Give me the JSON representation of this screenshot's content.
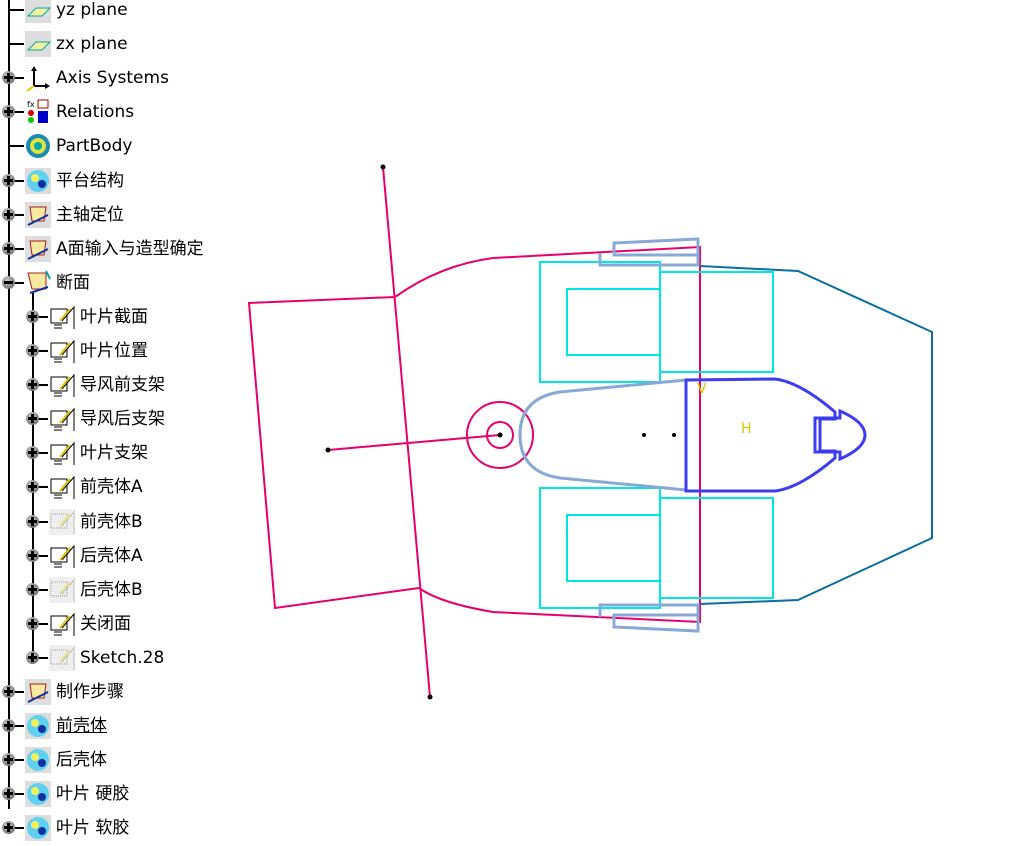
{
  "tree": {
    "items": [
      {
        "label": "yz plane",
        "icon": "plane-icon",
        "expander": "none",
        "level": 0
      },
      {
        "label": "zx plane",
        "icon": "plane-icon",
        "expander": "none",
        "level": 0
      },
      {
        "label": "Axis Systems",
        "icon": "axis-system-icon",
        "expander": "plus",
        "level": 0
      },
      {
        "label": "Relations",
        "icon": "relations-icon",
        "expander": "plus",
        "level": 0
      },
      {
        "label": "PartBody",
        "icon": "part-body-icon",
        "expander": "none",
        "level": 0
      },
      {
        "label": "平台结构",
        "icon": "geometrical-set-icon",
        "expander": "plus",
        "level": 0
      },
      {
        "label": "主轴定位",
        "icon": "ordered-geometrical-set-icon",
        "expander": "plus",
        "level": 0
      },
      {
        "label": "A面输入与造型确定",
        "icon": "ordered-geometrical-set-icon",
        "expander": "plus",
        "level": 0
      },
      {
        "label": "断面",
        "icon": "ordered-geometrical-set-open-icon",
        "expander": "minus",
        "level": 0
      },
      {
        "label": "叶片截面",
        "icon": "sketch-icon",
        "expander": "plus",
        "level": 1
      },
      {
        "label": "叶片位置",
        "icon": "sketch-icon",
        "expander": "plus",
        "level": 1
      },
      {
        "label": "导风前支架",
        "icon": "sketch-icon",
        "expander": "plus",
        "level": 1
      },
      {
        "label": "导风后支架",
        "icon": "sketch-icon",
        "expander": "plus",
        "level": 1
      },
      {
        "label": "叶片支架",
        "icon": "sketch-icon",
        "expander": "plus",
        "level": 1
      },
      {
        "label": "前壳体A",
        "icon": "sketch-icon",
        "expander": "plus",
        "level": 1
      },
      {
        "label": "前壳体B",
        "icon": "sketch-hidden-icon",
        "expander": "plus",
        "level": 1
      },
      {
        "label": "后壳体A",
        "icon": "sketch-icon",
        "expander": "plus",
        "level": 1
      },
      {
        "label": "后壳体B",
        "icon": "sketch-hidden-icon",
        "expander": "plus",
        "level": 1
      },
      {
        "label": "关闭面",
        "icon": "sketch-icon",
        "expander": "plus",
        "level": 1
      },
      {
        "label": "Sketch.28",
        "icon": "sketch-hidden-icon",
        "expander": "plus",
        "level": 1
      },
      {
        "label": "制作步骤",
        "icon": "ordered-geometrical-set-icon",
        "expander": "plus",
        "level": 0
      },
      {
        "label": "前壳体",
        "icon": "geometrical-set-icon",
        "expander": "plus",
        "level": 0,
        "underlined": true
      },
      {
        "label": "后壳体",
        "icon": "geometrical-set-icon",
        "expander": "plus",
        "level": 0
      },
      {
        "label": "叶片 硬胶",
        "icon": "geometrical-set-icon",
        "expander": "plus",
        "level": 0
      },
      {
        "label": "叶片 软胶",
        "icon": "geometrical-set-icon",
        "expander": "plus",
        "level": 0
      }
    ]
  },
  "viewport": {
    "colors": {
      "construction": "#e6006e",
      "cyan": "#00e6e6",
      "steel": "#88a8d8",
      "blue": "#3c3cf0",
      "teal": "#0a6ea0",
      "annotation": "#d8c800",
      "point": "#000000"
    },
    "annotations": {
      "v_label": "V",
      "h_label": "H"
    }
  }
}
